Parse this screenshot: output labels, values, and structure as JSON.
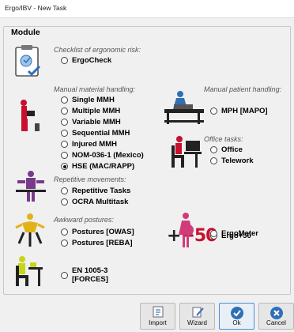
{
  "window": {
    "title": "Ergo/IBV - New Task"
  },
  "group": {
    "label": "Module"
  },
  "sections": {
    "checklist": {
      "caption": "Checklist of ergonomic risk:",
      "options": [
        "ErgoCheck"
      ]
    },
    "mmh": {
      "caption": "Manual material handling:",
      "options": [
        "Single MMH",
        "Multiple MMH",
        "Variable MMH",
        "Sequential MMH",
        "Injured MMH",
        "NOM-036-1 (Mexico)",
        "HSE (MAC/RAPP)"
      ],
      "selected": "HSE (MAC/RAPP)"
    },
    "patient": {
      "caption": "Manual patient handling:",
      "options": [
        "MPH [MAPO]"
      ]
    },
    "office": {
      "caption": "Office tasks:",
      "options": [
        "Office",
        "Telework"
      ]
    },
    "repetitive": {
      "caption": "Repetitive movements:",
      "options": [
        "Repetitive Tasks",
        "OCRA Multitask"
      ]
    },
    "ergo50": {
      "badge": "+50",
      "options": [
        "Ergo+50"
      ]
    },
    "awkward": {
      "caption": "Awkward postures:",
      "options": [
        "Postures [OWAS]",
        "Postures [REBA]"
      ]
    },
    "ergomater": {
      "options": [
        "ErgoMater"
      ]
    },
    "forces": {
      "options": [
        "EN 1005-3\n[FORCES]"
      ],
      "line1": "EN 1005-3",
      "line2": "[FORCES]"
    }
  },
  "buttons": {
    "import": "Import",
    "wizard": "Wizard",
    "ok": "Ok",
    "cancel": "Cancel"
  },
  "colors": {
    "accent_blue": "#2f6fb8",
    "figure_red": "#c8102e",
    "figure_purple": "#7a3a8c",
    "figure_yellow": "#e3b21b",
    "figure_pink": "#d13b7a",
    "figure_green": "#c6d41a"
  }
}
